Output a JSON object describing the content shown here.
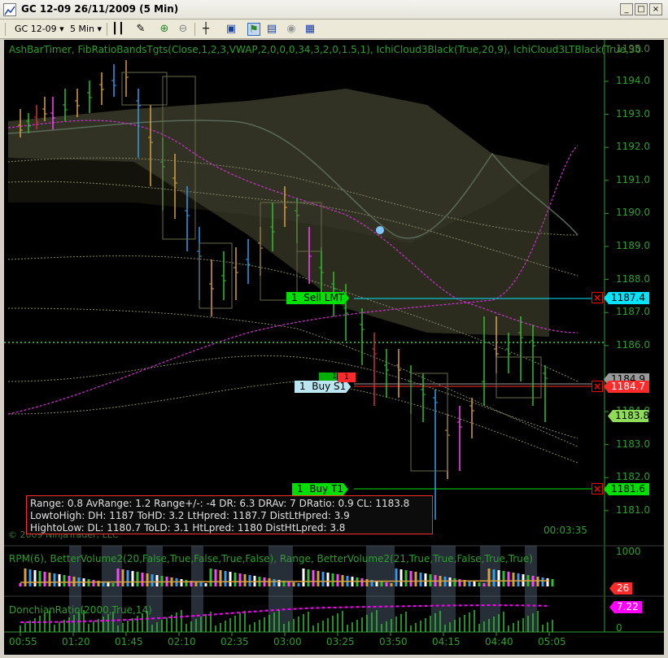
{
  "window": {
    "title": "GC 12-09  26/11/2009 (5 Min)",
    "controls": [
      "_",
      "□",
      "×"
    ]
  },
  "toolbar": {
    "instrument": "GC 12-09",
    "interval": "5 Min",
    "icons": [
      "bar-type-icon",
      "pencil-icon",
      "zoom-in-icon",
      "zoom-out-icon",
      "crosshair-icon",
      "data-box-icon",
      "indicators-icon",
      "strategies-icon",
      "properties-icon",
      "chart-trader-icon"
    ]
  },
  "price_panel": {
    "indicators_text": "AshBarTimer,  FibRatioBandsTgts(Close,1,2,3,VWAP,2,0,0,0,34,3,2,0,1.5,1),  IchiCloud3Black(True,20,9),  IchiCloud3LTBlack(True,30",
    "axis_labels": [
      "1194.0",
      "1193.0",
      "1192.0",
      "1191.0",
      "1190.0",
      "1189.0",
      "1188.0",
      "1187.0",
      "1186.0",
      "1185.0",
      "1184.0",
      "1183.0",
      "1182.0",
      "1181.0"
    ],
    "top_cut_label": "1195.0",
    "copyright": "© 2009 NinjaTrader, LLC",
    "bar_timer": "00:03:35",
    "price_tags": {
      "sell_lmt": "1187.4",
      "buy_s1": "1184.7",
      "last_hidden": "1184.9",
      "cur": "1183.8",
      "buy_t1": "1181.6"
    },
    "orders": {
      "sell_lmt": {
        "qty": "1",
        "label": "Sell LMT"
      },
      "buy_s1": {
        "qty": "1",
        "label": "Buy S1"
      },
      "buy_t1": {
        "qty": "1",
        "label": "Buy T1"
      },
      "stacked_qty": "1",
      "stacked_marker": "1"
    },
    "close_icon": "×",
    "info": {
      "line1": "Range:  0.8   AvRange:  1.2   Range+/-:  -4  DR:  6.3  DRAv:  7  DRatio:  0.9  CL:  1183.8",
      "line2": "LowtoHigh:     DH:  1187  ToHD:  3.2  LtHpred:  1187.7  DistLtHpred:  3.9",
      "line3": "HightoLow:     DL:  1180.7  ToLD:  3.1  HtLpred:  1180  DistHtLpred:  3.8"
    }
  },
  "volume_panel": {
    "indicators_text": "RPM(6),   BetterVolume2(20,False,True,False,True,False),   Range,   BetterVolume2(21,True,True,False,True,True)",
    "axis_label": "1000",
    "tag_value": "26"
  },
  "donchian_panel": {
    "indicators_text": "DonchianRatio(2000,True,14)",
    "tag_value": "7.22",
    "axis_label": "0"
  },
  "time_axis": [
    "00:55",
    "01:20",
    "01:45",
    "02:10",
    "02:35",
    "03:00",
    "03:25",
    "03:50",
    "04:15",
    "04:40",
    "05:05"
  ],
  "colors": {
    "background": "#000000",
    "axis_text": "#2e9e2e",
    "sell_line": "#00e5ff",
    "buy_s1_line": "#ff2a2a",
    "buy_t1_line": "#00ff00",
    "order_green": "#00e000",
    "order_lightblue": "#b9e6f0",
    "current_tag": "#8fdc5a",
    "donchian_tag": "#ff00ff"
  }
}
